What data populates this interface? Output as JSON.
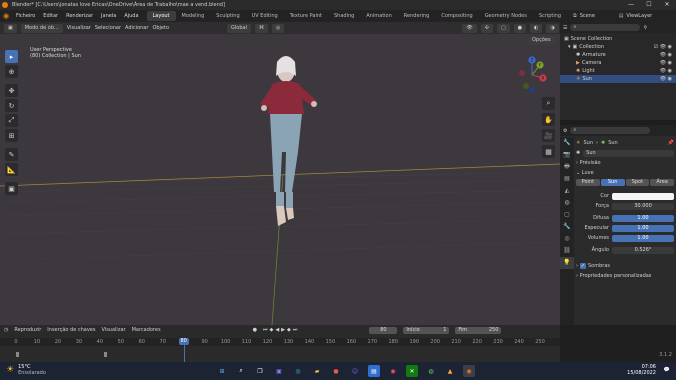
{
  "window": {
    "title": "Blender* [C:\\Users\\jonatas love Ericas\\OneDrive\\Área de Trabalho\\mae a vend.blend]",
    "min": "—",
    "max": "☐",
    "close": "✕"
  },
  "menu": [
    "Ficheiro",
    "Editar",
    "Renderizar",
    "Janela",
    "Ajuda"
  ],
  "workspaces": [
    "Layout",
    "Modeling",
    "Sculpting",
    "UV Editing",
    "Texture Paint",
    "Shading",
    "Animation",
    "Rendering",
    "Compositing",
    "Geometry Nodes",
    "Scripting"
  ],
  "scene": {
    "name": "Scene",
    "viewlayer": "ViewLayer"
  },
  "viewport": {
    "mode": "Modo de ob...",
    "menus": [
      "Visualizar",
      "Selecionar",
      "Adicionar",
      "Objeto"
    ],
    "transform": "Global",
    "options": "Opções",
    "info_line1": "User Perspective",
    "info_line2": "(80) Collection | Sun",
    "gizmo": {
      "x": "X",
      "y": "Y",
      "z": "Z"
    }
  },
  "outliner": {
    "search_placeholder": "",
    "items": [
      {
        "label": "Scene Collection",
        "icon": "collection-icon",
        "selected": false
      },
      {
        "label": "Collection",
        "icon": "collection-icon",
        "selected": false
      },
      {
        "label": "Armature",
        "icon": "armature-icon",
        "selected": false
      },
      {
        "label": "Camera",
        "icon": "camera-icon",
        "selected": false
      },
      {
        "label": "Light",
        "icon": "light-icon",
        "selected": false
      },
      {
        "label": "Sun",
        "icon": "sun-icon",
        "selected": true
      }
    ]
  },
  "properties": {
    "breadcrumb_object": "Sun",
    "breadcrumb_data": "Sun",
    "name": "Sun",
    "preview_label": "Prévisão",
    "light_label": "Luve",
    "light_types": [
      "Point",
      "Sun",
      "Spot",
      "Área"
    ],
    "active_type": "Sun",
    "fields": [
      {
        "label": "Cor",
        "value": "",
        "kind": "color"
      },
      {
        "label": "Força",
        "value": "30.000",
        "kind": "plain"
      },
      {
        "label": "Difusa",
        "value": "1.00",
        "kind": "blue"
      },
      {
        "label": "Especular",
        "value": "1.00",
        "kind": "blue"
      },
      {
        "label": "Volumes",
        "value": "1.00",
        "kind": "blue"
      },
      {
        "label": "Ângulo",
        "value": "0.526°",
        "kind": "plain"
      }
    ],
    "shadows_label": "Sombras",
    "custom_props_label": "Propriedades personalizadas"
  },
  "timeline": {
    "menus": [
      "Reproduzir",
      "Inserção de chaves",
      "Visualizar",
      "Marcadores"
    ],
    "current_frame": "80",
    "start_label": "Início",
    "start": "1",
    "end_label": "Fim",
    "end": "250",
    "ticks": [
      "0",
      "10",
      "20",
      "30",
      "40",
      "50",
      "60",
      "70",
      "80",
      "90",
      "100",
      "110",
      "120",
      "130",
      "140",
      "150",
      "160",
      "170",
      "180",
      "190",
      "200",
      "210",
      "220",
      "230",
      "240",
      "250"
    ]
  },
  "status": {
    "version": "3.1.2"
  },
  "taskbar": {
    "temp": "15°C",
    "weather": "Ensolarado",
    "time": "07:06",
    "date": "15/08/2022"
  },
  "colors": {
    "accent": "#4772b3",
    "selected_row": "#334d80",
    "blender_orange": "#e87d0d"
  }
}
